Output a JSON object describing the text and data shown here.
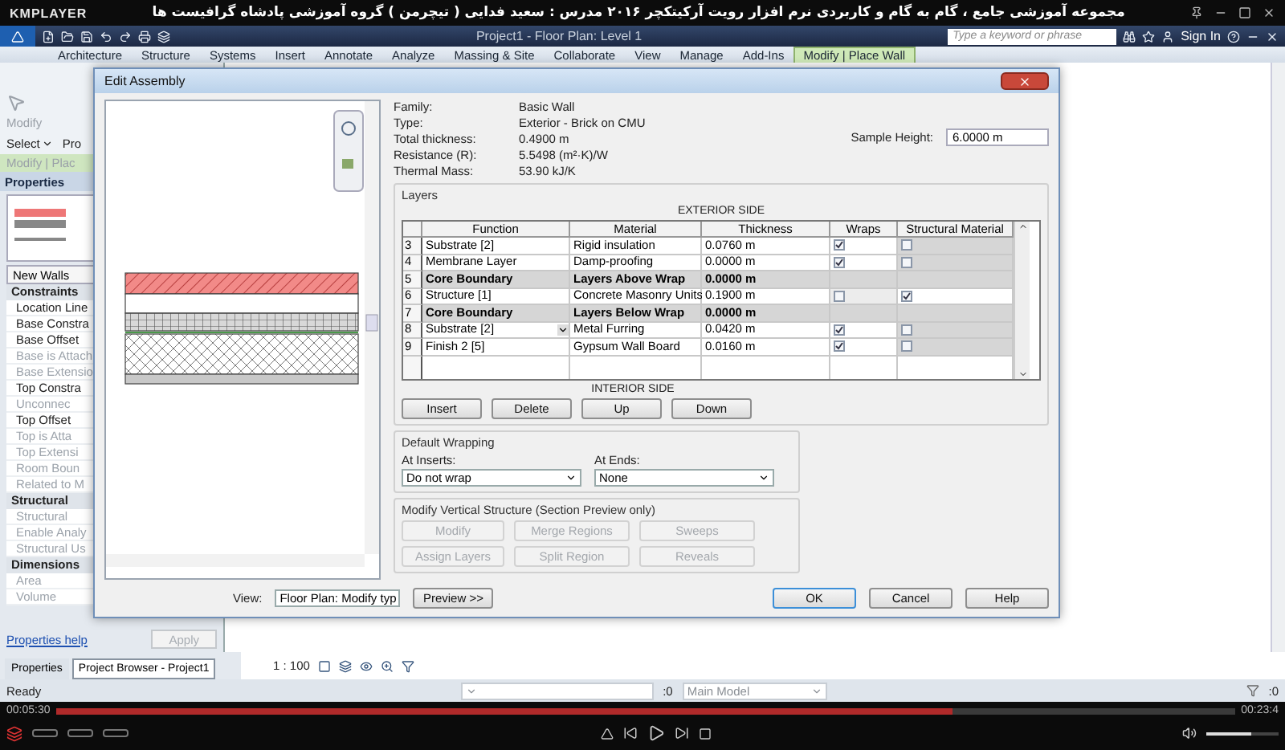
{
  "player": {
    "logo": "KMPLAYER",
    "title": "مجموعه آموزشی جامع ، گام به گام و کاربردی نرم افزار رویت آرکیتکچر ۲۰۱۶   مدرس : سعید فدایی ( تیچرمن ) گروه آموزشی پادشاه گرافیست ها",
    "time_elapsed": "00:05:30",
    "time_total": "00:23:4",
    "progress": {
      "level": 0.76
    },
    "volume": {
      "level": 0.62
    }
  },
  "revit": {
    "document_title": "Project1 - Floor Plan: Level 1",
    "search": {
      "placeholder": "Type a keyword or phrase"
    },
    "sign_in": "Sign In",
    "ribbon_tabs": [
      {
        "label": "Architecture",
        "selected": false
      },
      {
        "label": "Structure",
        "selected": false
      },
      {
        "label": "Systems",
        "selected": false
      },
      {
        "label": "Insert",
        "selected": false
      },
      {
        "label": "Annotate",
        "selected": false
      },
      {
        "label": "Analyze",
        "selected": false
      },
      {
        "label": "Massing & Site",
        "selected": false
      },
      {
        "label": "Collaborate",
        "selected": false
      },
      {
        "label": "View",
        "selected": false
      },
      {
        "label": "Manage",
        "selected": false
      },
      {
        "label": "Add-Ins",
        "selected": false
      },
      {
        "label": "Modify | Place Wall",
        "selected": true
      }
    ],
    "ribbon_panel": {
      "modify": "Modify",
      "select": "Select",
      "project_cut": "Pro",
      "context_label": "Modify | Plac"
    },
    "properties": {
      "title": "Properties",
      "type_selector": "New Walls",
      "groups": [
        {
          "name": "Constraints",
          "rows": [
            {
              "label": "Location Line",
              "disabled": false
            },
            {
              "label": "Base Constra",
              "disabled": false
            },
            {
              "label": "Base Offset",
              "disabled": false
            },
            {
              "label": "Base is Attach",
              "disabled": true
            },
            {
              "label": "Base Extensio",
              "disabled": true
            },
            {
              "label": "Top Constra",
              "disabled": false
            },
            {
              "label": "Unconnec",
              "disabled": true
            },
            {
              "label": "Top Offset",
              "disabled": false
            },
            {
              "label": "Top is Atta",
              "disabled": true
            },
            {
              "label": "Top Extensi",
              "disabled": true
            },
            {
              "label": "Room Boun",
              "disabled": true
            },
            {
              "label": "Related to M",
              "disabled": true
            }
          ]
        },
        {
          "name": "Structural",
          "rows": [
            {
              "label": "Structural",
              "disabled": true
            },
            {
              "label": "Enable Analy",
              "disabled": true
            },
            {
              "label": "Structural Us",
              "disabled": true
            }
          ]
        },
        {
          "name": "Dimensions",
          "rows": [
            {
              "label": "Area",
              "disabled": true
            },
            {
              "label": "Volume",
              "disabled": true
            }
          ]
        }
      ],
      "help_link": "Properties help",
      "apply": {
        "label": "Apply",
        "disabled": true
      }
    },
    "panel_tabs": [
      {
        "label": "Properties",
        "selected": false
      },
      {
        "label": "Project Browser - Project1",
        "selected": true
      }
    ],
    "view_bar": {
      "scale": "1 : 100"
    },
    "status_bar": {
      "text": "Ready",
      "design_option_count": ":0",
      "workset": "Main Model",
      "filter_count": ":0"
    }
  },
  "dialog": {
    "title": "Edit Assembly",
    "info": [
      {
        "label": "Family:",
        "value": "Basic Wall"
      },
      {
        "label": "Type:",
        "value": "Exterior - Brick on CMU"
      },
      {
        "label": "Total thickness:",
        "value": "0.4900 m"
      },
      {
        "label": "Resistance (R):",
        "value": "5.5498 (m²·K)/W"
      },
      {
        "label": "Thermal Mass:",
        "value": "53.90 kJ/K"
      }
    ],
    "sample_height": {
      "label": "Sample Height:",
      "value": "6.0000 m"
    },
    "layers": {
      "legend": "Layers",
      "exterior_label": "EXTERIOR SIDE",
      "interior_label": "INTERIOR SIDE",
      "columns": [
        "Function",
        "Material",
        "Thickness",
        "Wraps",
        "Structural Material"
      ],
      "rows": [
        {
          "number": "3",
          "kind": "layer",
          "function": "Substrate [2]",
          "material": "Rigid insulation",
          "thickness": "0.0760 m",
          "wraps": true,
          "structural": false,
          "editing": false
        },
        {
          "number": "4",
          "kind": "layer",
          "function": "Membrane Layer",
          "material": "Damp-proofing",
          "thickness": "0.0000 m",
          "wraps": true,
          "structural": false,
          "editing": false
        },
        {
          "number": "5",
          "kind": "boundary",
          "function": "Core Boundary",
          "material": "Layers Above Wrap",
          "thickness": "0.0000 m",
          "editing": false
        },
        {
          "number": "6",
          "kind": "layer",
          "function": "Structure [1]",
          "material": "Concrete Masonry Units",
          "thickness": "0.1900 m",
          "wraps": false,
          "structural": true,
          "editing": false
        },
        {
          "number": "7",
          "kind": "boundary",
          "function": "Core Boundary",
          "material": "Layers Below Wrap",
          "thickness": "0.0000 m",
          "editing": false
        },
        {
          "number": "8",
          "kind": "layer",
          "function": "Substrate [2]",
          "material": "Metal Furring",
          "thickness": "0.0420 m",
          "wraps": true,
          "structural": false,
          "editing": true
        },
        {
          "number": "9",
          "kind": "layer",
          "function": "Finish 2 [5]",
          "material": "Gypsum Wall Board",
          "thickness": "0.0160 m",
          "wraps": true,
          "structural": false,
          "editing": false
        }
      ],
      "buttons": [
        "Insert",
        "Delete",
        "Up",
        "Down"
      ]
    },
    "default_wrapping": {
      "legend": "Default Wrapping",
      "at_inserts": {
        "label": "At Inserts:",
        "value": "Do not wrap"
      },
      "at_ends": {
        "label": "At Ends:",
        "value": "None"
      }
    },
    "vertical_structure": {
      "legend": "Modify Vertical Structure (Section Preview only)",
      "buttons": [
        {
          "label": "Modify",
          "disabled": true
        },
        {
          "label": "Merge Regions",
          "disabled": true
        },
        {
          "label": "Sweeps",
          "disabled": true
        },
        {
          "label": "Assign Layers",
          "disabled": true
        },
        {
          "label": "Split Region",
          "disabled": true
        },
        {
          "label": "Reveals",
          "disabled": true
        }
      ]
    },
    "view": {
      "label": "View:",
      "value": "Floor Plan: Modify typ"
    },
    "preview_button": "Preview >>",
    "buttons": [
      {
        "label": "OK",
        "default": true
      },
      {
        "label": "Cancel",
        "default": false
      },
      {
        "label": "Help",
        "default": false
      }
    ]
  }
}
